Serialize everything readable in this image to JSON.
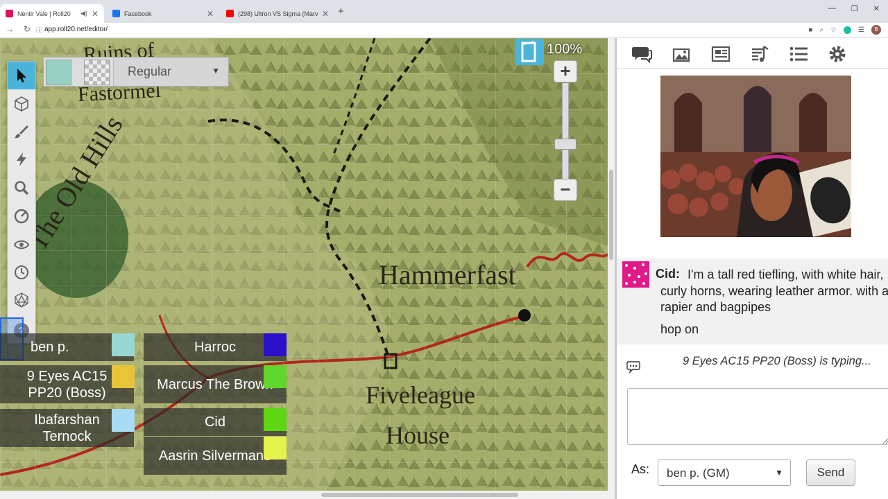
{
  "browser": {
    "tabs": [
      {
        "title": "Nentir Vale | Roll20",
        "favicon_color": "#e0115f",
        "active": true
      },
      {
        "title": "Facebook",
        "favicon_color": "#1877f2",
        "active": false
      },
      {
        "title": "(298) Ultron VS Sigma (Marvel V",
        "favicon_color": "#ff0000",
        "active": false
      }
    ],
    "new_tab": "+",
    "url": "app.roll20.net/editor/",
    "profile_initial": "B"
  },
  "map": {
    "labels": {
      "ruins": "Ruins of",
      "fastormel": "Fastormel",
      "old_hills": "The Old Hills",
      "hammerfast": "Hammerfast",
      "fiveleague1": "Fiveleague",
      "fiveleague2": "House"
    },
    "layer": {
      "name": "Regular",
      "fill_color": "#97d1c6"
    },
    "zoom": "100%"
  },
  "players": [
    {
      "name": "ben p.",
      "color": "#97d8d2"
    },
    {
      "name": "9 Eyes AC15 PP20 (Boss)",
      "color": "#e8c43a"
    },
    {
      "name": "Ibafarshan Ternock",
      "color": "#a8dcf5"
    },
    {
      "name": "Harroc",
      "color": "#2a10c8"
    },
    {
      "name": "Marcus The Brown",
      "color": "#5fd62a"
    },
    {
      "name": "Cid",
      "color": "#5fd612"
    },
    {
      "name": "Aasrin Silvermane",
      "color": "#e4f24a"
    }
  ],
  "chat": {
    "message": {
      "sender": "Cid:",
      "text": "I'm a tall red tiefling, with white hair, curly horns, wearing leather armor. with a rapier and bagpipes",
      "text2": "hop on"
    },
    "typing": "9 Eyes AC15 PP20 (Boss) is typing...",
    "input_value": "",
    "as_label": "As:",
    "as_value": "ben p. (GM)",
    "send_label": "Send"
  }
}
